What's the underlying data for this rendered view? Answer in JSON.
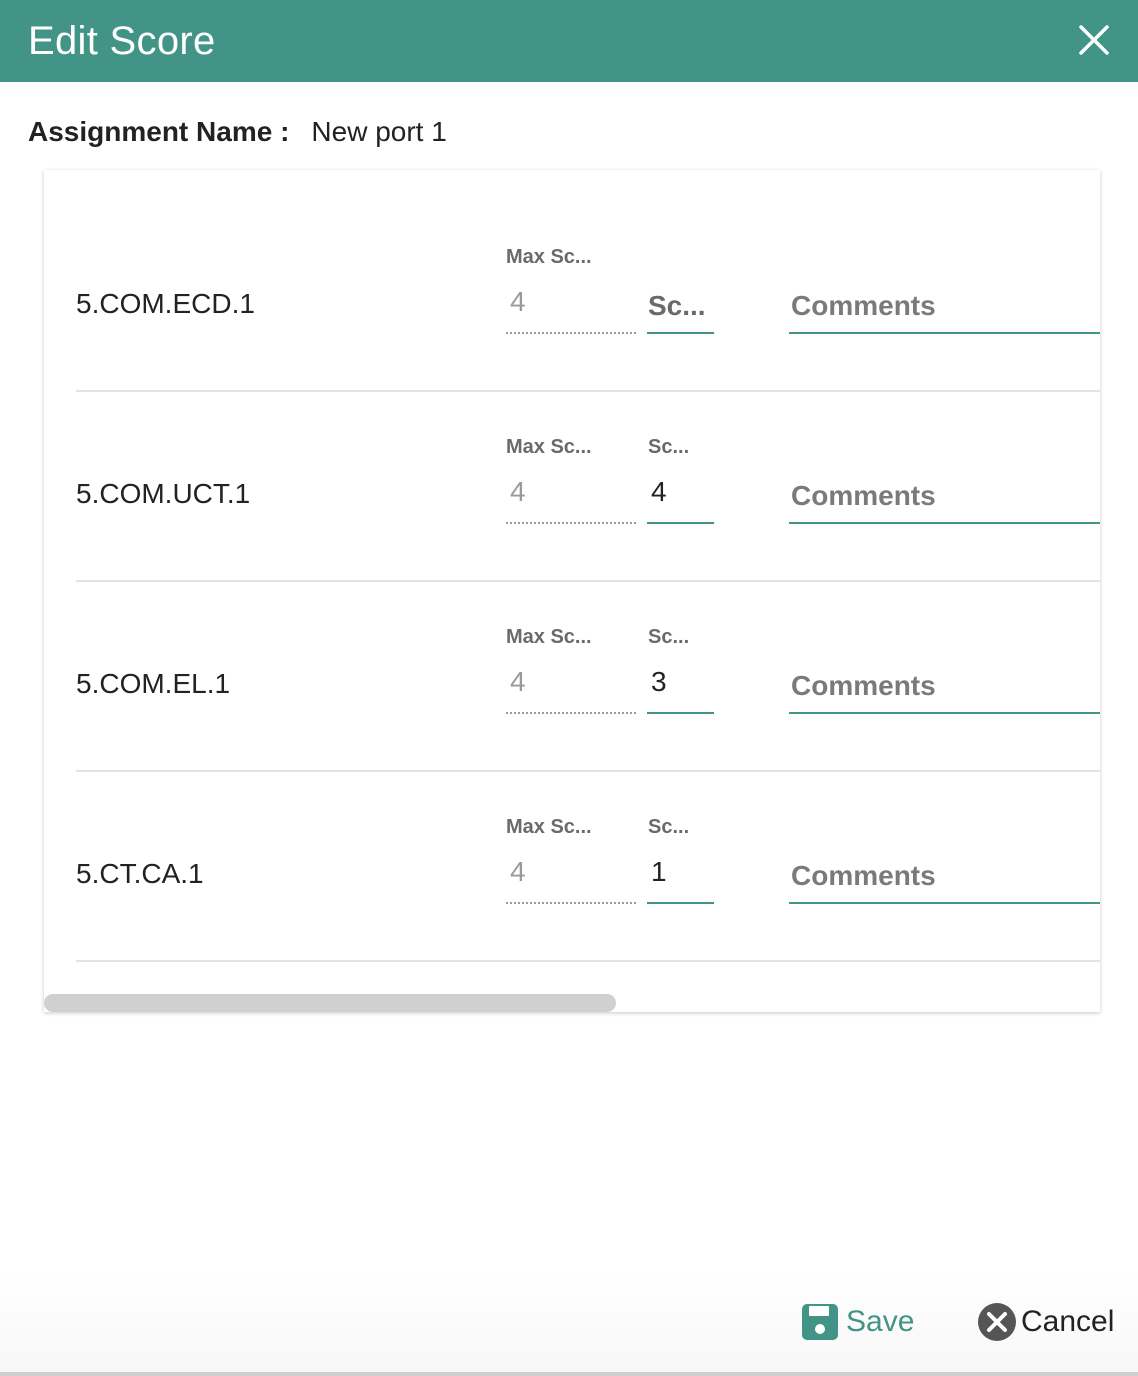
{
  "dialog": {
    "title": "Edit Score",
    "close_icon": "close-icon"
  },
  "assignment": {
    "label": "Assignment Name :",
    "value": "New port 1"
  },
  "rows": [
    {
      "code": "5.COM.ECD.1",
      "max_label": "Max Sc...",
      "max_value": "4",
      "score_label": "Sc...",
      "score_value": "",
      "comments_placeholder": "Comments"
    },
    {
      "code": "5.COM.UCT.1",
      "max_label": "Max Sc...",
      "max_value": "4",
      "score_label": "Sc...",
      "score_value": "4",
      "comments_placeholder": "Comments"
    },
    {
      "code": "5.COM.EL.1",
      "max_label": "Max Sc...",
      "max_value": "4",
      "score_label": "Sc...",
      "score_value": "3",
      "comments_placeholder": "Comments"
    },
    {
      "code": "5.CT.CA.1",
      "max_label": "Max Sc...",
      "max_value": "4",
      "score_label": "Sc...",
      "score_value": "1",
      "comments_placeholder": "Comments"
    }
  ],
  "footer": {
    "save_label": "Save",
    "cancel_label": "Cancel",
    "save_icon": "save-icon",
    "cancel_icon": "cancel-circle-icon"
  },
  "colors": {
    "accent": "#419486",
    "header_text": "#ffffff",
    "muted": "#9a9a9a",
    "cancel_icon": "#555555"
  }
}
